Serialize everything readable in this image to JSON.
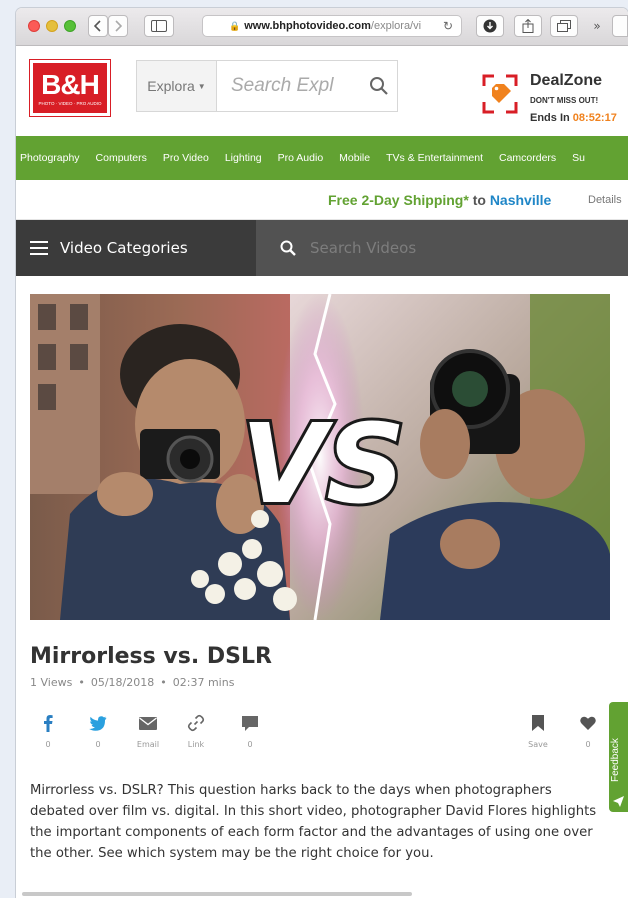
{
  "browser": {
    "url_host": "www.bhphotovideo.com",
    "url_path": "/explora/vi"
  },
  "header": {
    "logo_text": "B&H",
    "logo_sub": "PHOTO · VIDEO · PRO AUDIO",
    "explora_label": "Explora",
    "search_placeholder": "Search Expl",
    "dealzone_title": "DealZone",
    "dealzone_sub": "DON'T MISS OUT!",
    "dealzone_ends_label": "Ends In",
    "dealzone_timer": "08:52:17"
  },
  "nav": {
    "items": [
      "Photography",
      "Computers",
      "Pro Video",
      "Lighting",
      "Pro Audio",
      "Mobile",
      "TVs & Entertainment",
      "Camcorders",
      "Su"
    ]
  },
  "shipping": {
    "main": "Free 2-Day Shipping*",
    "to": "to",
    "city": "Nashville",
    "details": "Details"
  },
  "video_bar": {
    "categories_label": "Video Categories",
    "search_placeholder": "Search Videos"
  },
  "thumbnail": {
    "overlay_text": "VS"
  },
  "article": {
    "title": "Mirrorless vs. DSLR",
    "views": "1 Views",
    "date": "05/18/2018",
    "duration": "02:37 mins",
    "description": "Mirrorless vs. DSLR? This question harks back to the days when photographers debated over film vs. digital. In this short video, photographer David Flores highlights the important components of each form factor and the advantages of using one over the other. See which system may be the right choice for you."
  },
  "share": {
    "facebook_count": "0",
    "twitter_count": "0",
    "email_label": "Email",
    "link_label": "Link",
    "comments_count": "0",
    "save_label": "Save",
    "likes_count": "0"
  },
  "feedback_label": "Feedback",
  "colors": {
    "brand_red": "#d81e26",
    "nav_green": "#62a232",
    "link_blue": "#1f86c7",
    "timer_orange": "#f0821e"
  }
}
